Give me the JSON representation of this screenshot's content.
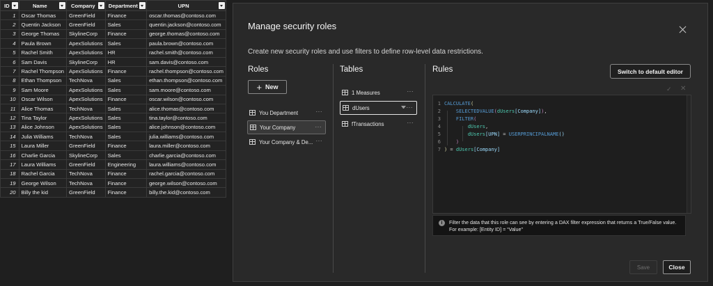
{
  "table": {
    "headers": [
      "ID",
      "Name",
      "Company",
      "Department",
      "UPN"
    ],
    "rows": [
      [
        "1",
        "Oscar Thomas",
        "GreenField",
        "Finance",
        "oscar.thomas@contoso.com"
      ],
      [
        "2",
        "Quentin Jackson",
        "GreenField",
        "Sales",
        "quentin.jackson@contoso.com"
      ],
      [
        "3",
        "George Thomas",
        "SkylineCorp",
        "Finance",
        "george.thomas@contoso.com"
      ],
      [
        "4",
        "Paula Brown",
        "ApexSolutions",
        "Sales",
        "paula.brown@contoso.com"
      ],
      [
        "5",
        "Rachel Smith",
        "ApexSolutions",
        "HR",
        "rachel.smith@contoso.com"
      ],
      [
        "6",
        "Sam Davis",
        "SkylineCorp",
        "HR",
        "sam.davis@contoso.com"
      ],
      [
        "7",
        "Rachel Thompson",
        "ApexSolutions",
        "Finance",
        "rachel.thompson@contoso.com"
      ],
      [
        "8",
        "Ethan Thompson",
        "TechNova",
        "Sales",
        "ethan.thompson@contoso.com"
      ],
      [
        "9",
        "Sam Moore",
        "ApexSolutions",
        "Sales",
        "sam.moore@contoso.com"
      ],
      [
        "10",
        "Oscar Wilson",
        "ApexSolutions",
        "Finance",
        "oscar.wilson@contoso.com"
      ],
      [
        "11",
        "Alice Thomas",
        "TechNova",
        "Sales",
        "alice.thomas@contoso.com"
      ],
      [
        "12",
        "Tina Taylor",
        "ApexSolutions",
        "Sales",
        "tina.taylor@contoso.com"
      ],
      [
        "13",
        "Alice Johnson",
        "ApexSolutions",
        "Sales",
        "alice.johnson@contoso.com"
      ],
      [
        "14",
        "Julia Williams",
        "TechNova",
        "Sales",
        "julia.williams@contoso.com"
      ],
      [
        "15",
        "Laura Miller",
        "GreenField",
        "Finance",
        "laura.miller@contoso.com"
      ],
      [
        "16",
        "Charlie Garcia",
        "SkylineCorp",
        "Sales",
        "charlie.garcia@contoso.com"
      ],
      [
        "17",
        "Laura Williams",
        "GreenField",
        "Engineering",
        "laura.williams@contoso.com"
      ],
      [
        "18",
        "Rachel Garcia",
        "TechNova",
        "Finance",
        "rachel.garcia@contoso.com"
      ],
      [
        "19",
        "George Wilson",
        "TechNova",
        "Finance",
        "george.wilson@contoso.com"
      ],
      [
        "20",
        "Billy the kid",
        "GreenField",
        "Finance",
        "billy.the.kid@contoso.com"
      ]
    ]
  },
  "dialog": {
    "title": "Manage security roles",
    "subtitle": "Create new security roles and use filters to define row-level data restrictions.",
    "roles_heading": "Roles",
    "tables_heading": "Tables",
    "rules_heading": "Rules",
    "new_label": "New",
    "switch_label": "Switch to default editor",
    "roles": [
      {
        "label": "You Department",
        "selected": false
      },
      {
        "label": "Your Company",
        "selected": true
      },
      {
        "label": "Your Company & De...",
        "selected": false
      }
    ],
    "tables": [
      {
        "label": "1 Measures",
        "active": false
      },
      {
        "label": "dUsers",
        "active": true
      },
      {
        "label": "fTransactions",
        "active": false
      }
    ],
    "more_glyph": "···",
    "info_text": "Filter the data that this role can see by entering a DAX filter expression that returns a True/False value. For example: [Entity ID] = “Value”",
    "save_label": "Save",
    "close_label": "Close"
  },
  "colors": {
    "background": "#1f1f1f",
    "dialog": "#292929",
    "keyword": "#569cd6",
    "function": "#dcdcaa",
    "column": "#4ec9b0",
    "bracket": "#c586c0"
  },
  "icons": [
    "close-icon",
    "plus-icon",
    "role-icon",
    "table-icon",
    "filter-icon",
    "info-icon",
    "check-icon",
    "dropdown-arrow-icon"
  ]
}
